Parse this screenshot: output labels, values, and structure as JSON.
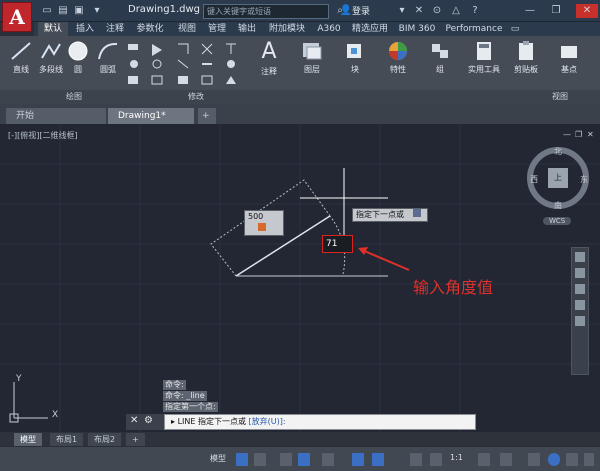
{
  "app": {
    "logo": "A",
    "title": "Drawing1.dwg",
    "search_placeholder": "键入关键字或短语",
    "login": "登录"
  },
  "ribbon_tabs": [
    "默认",
    "插入",
    "注释",
    "参数化",
    "视图",
    "管理",
    "输出",
    "附加模块",
    "A360",
    "精选应用",
    "BIM 360",
    "Performance"
  ],
  "ribbon": {
    "draw_tools": [
      "直线",
      "多段线",
      "圆",
      "圆弧"
    ],
    "big_tools": [
      "注释",
      "图层",
      "块",
      "特性",
      "组",
      "实用工具",
      "剪贴板",
      "基点"
    ],
    "panels": [
      "绘图",
      "修改",
      "视图"
    ]
  },
  "doc_tabs": [
    "开始",
    "Drawing1*"
  ],
  "canvas": {
    "view_label": "[-][俯视][二维线框]",
    "length_value": "500",
    "next_point_tip": "指定下一点或",
    "angle_input": "71",
    "annotation": "输入角度值",
    "y_axis": "Y",
    "x_axis": "X"
  },
  "viewcube": {
    "north": "北",
    "south": "南",
    "east": "东",
    "west": "西",
    "top": "上",
    "wcs": "WCS"
  },
  "command": {
    "history": [
      "命令:",
      "命令: _line",
      "指定第一个点:"
    ],
    "prompt_prefix": "LINE 指定下一点或",
    "prompt_option": "[放弃(U)]:"
  },
  "layout_tabs": [
    "模型",
    "布局1",
    "布局2"
  ],
  "status": {
    "model_label": "模型",
    "scale": "1:1"
  }
}
